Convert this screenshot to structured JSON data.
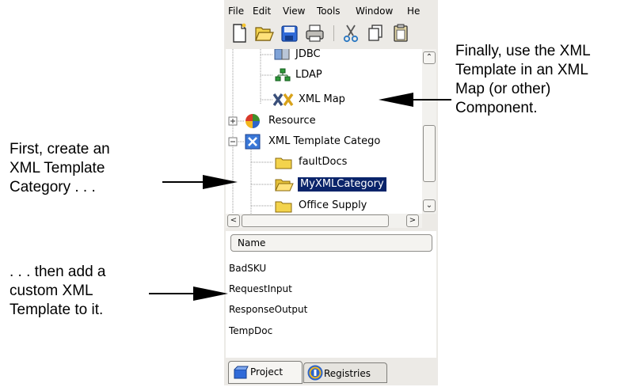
{
  "menu": [
    "File",
    "Edit",
    "View",
    "Tools",
    "Window",
    "He"
  ],
  "toolbar": {
    "buttons": [
      "new-file-icon",
      "open-folder-icon",
      "save-icon",
      "print-icon",
      "cut-icon",
      "copy-icon",
      "paste-icon"
    ]
  },
  "tree": {
    "items": [
      {
        "label": "JDBC",
        "icon": "jdbc-icon"
      },
      {
        "label": "LDAP",
        "icon": "ldap-icon"
      },
      {
        "label": "XML Map",
        "icon": "xml-map-icon"
      },
      {
        "label": "Resource",
        "icon": "resource-icon"
      },
      {
        "label": "XML Template Catego",
        "icon": "xml-template-icon"
      },
      {
        "label": "faultDocs",
        "icon": "folder-icon"
      },
      {
        "label": "MyXMLCategory",
        "icon": "folder-open-icon",
        "selected": true
      },
      {
        "label": "Office Supply",
        "icon": "folder-icon"
      }
    ]
  },
  "list": {
    "header": "Name",
    "rows": [
      "BadSKU",
      "RequestInput",
      "ResponseOutput",
      "TempDoc"
    ]
  },
  "tabs": [
    {
      "label": "Project",
      "active": true
    },
    {
      "label": "Registries",
      "active": false
    }
  ],
  "callouts": {
    "right": [
      "Finally, use the XML",
      "Template in an XML",
      "Map (or other)",
      "Component."
    ],
    "left_top": [
      "First, create an",
      "XML Template",
      "Category . . ."
    ],
    "left_bottom": [
      ". . . then add a",
      "custom XML",
      "Template to it."
    ]
  },
  "colors": {
    "selection": "#0a246a",
    "folder": "#f3d34c",
    "panel_bg": "#eceae6"
  }
}
